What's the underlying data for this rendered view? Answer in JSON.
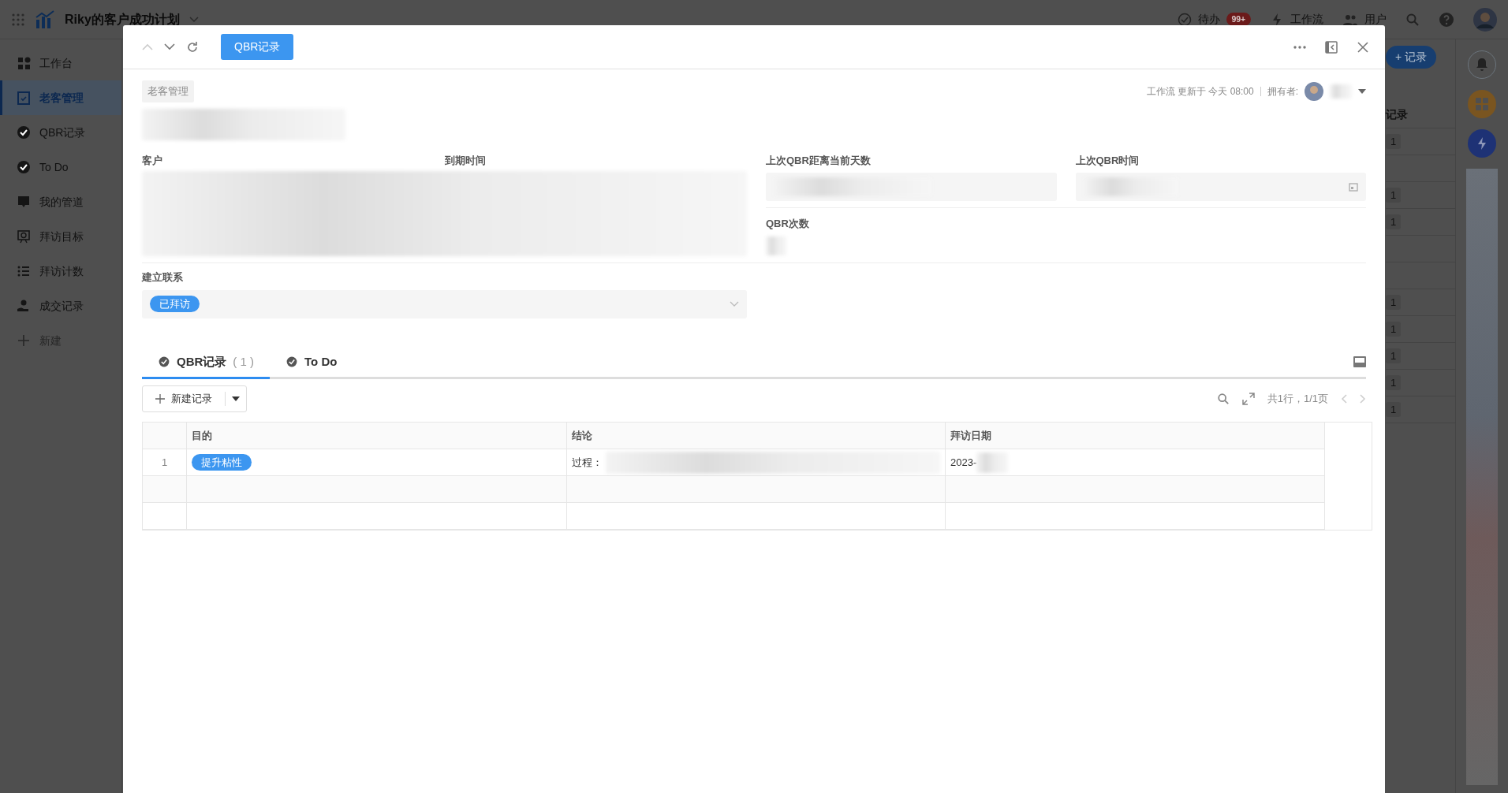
{
  "app_bar": {
    "title": "Riky的客户成功计划",
    "todo_label": "待办",
    "todo_badge": "99+",
    "workflow_label": "工作流",
    "users_label": "用户"
  },
  "sidebar": {
    "items": [
      {
        "label": "工作台",
        "kind": "dashboard",
        "selected": false
      },
      {
        "label": "老客管理",
        "kind": "form",
        "selected": true
      },
      {
        "label": "QBR记录",
        "kind": "check",
        "selected": false
      },
      {
        "label": "To Do",
        "kind": "check",
        "selected": false
      },
      {
        "label": "我的管道",
        "kind": "pipeline",
        "selected": false
      },
      {
        "label": "拜访目标",
        "kind": "target",
        "selected": false
      },
      {
        "label": "拜访计数",
        "kind": "list",
        "selected": false
      },
      {
        "label": "成交记录",
        "kind": "deal",
        "selected": false
      }
    ],
    "new_label": "新建"
  },
  "background": {
    "add_button": "+ 记录",
    "list_title": "记录",
    "rows": [
      {
        "kind": "badge",
        "badge": "1"
      },
      {
        "kind": "blank"
      },
      {
        "kind": "badge",
        "badge": "1"
      },
      {
        "kind": "badge",
        "badge": "1"
      },
      {
        "kind": "blank"
      },
      {
        "kind": "blank"
      },
      {
        "kind": "badge",
        "badge": "1"
      },
      {
        "kind": "badge",
        "badge": "1"
      },
      {
        "kind": "badge",
        "badge": "1"
      },
      {
        "kind": "badge",
        "badge": "1"
      },
      {
        "kind": "badge",
        "badge": "1"
      }
    ]
  },
  "modal": {
    "tag": "QBR记录",
    "breadcrumb": "老客管理",
    "meta": {
      "workflow": "工作流",
      "updated": "更新于 今天 08:00",
      "owner_label": "拥有者:"
    },
    "merged_fields": {
      "labels": [
        "客户",
        "到期时间"
      ]
    },
    "fields": [
      {
        "label": "上次QBR距离当前天数",
        "kind": "plain"
      },
      {
        "label": "上次QBR时间",
        "kind": "date"
      },
      {
        "label": "QBR次数",
        "kind": "small"
      }
    ],
    "contact": {
      "label": "建立联系",
      "value": "已拜访"
    },
    "tabs": [
      {
        "label": "QBR记录",
        "count": "( 1 )",
        "selected": true
      },
      {
        "label": "To Do",
        "selected": false
      }
    ],
    "toolbar": {
      "new_button": "新建记录",
      "pagination": "共1行，1/1页"
    },
    "table": {
      "columns": [
        "目的",
        "结论",
        "拜访日期"
      ],
      "rows": [
        {
          "index": "1",
          "purpose": "提升粘性",
          "conclusion": "过程：",
          "date": "2023-"
        }
      ]
    }
  }
}
